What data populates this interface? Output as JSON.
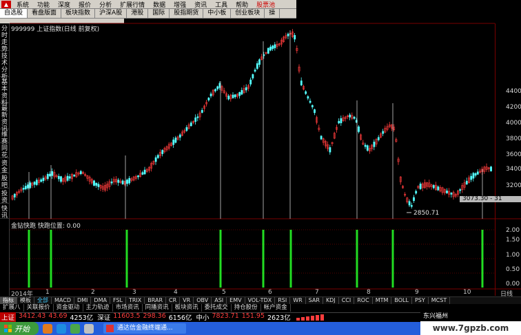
{
  "menu": [
    "系统",
    "功能",
    "深度",
    "报价",
    "分析",
    "扩展行情",
    "数据",
    "增强",
    "资讯",
    "工具",
    "帮助",
    "股票池"
  ],
  "tabs": [
    "自选股",
    "看盘版面",
    "板块指数",
    "沪深A股",
    "港股",
    "国际",
    "股指期货",
    "中小板",
    "创业板块",
    "操"
  ],
  "left_tabs": [
    "分时走势",
    "技术分析",
    "基本资料",
    "最新资讯",
    "维赛",
    "同花",
    "资金",
    "股吧",
    "投资",
    "快讯"
  ],
  "chart": {
    "title": "999999 上证指数(日线 前复权)",
    "y_ticks": [
      "4400",
      "4200",
      "4000",
      "3800",
      "3600",
      "3400",
      "3200",
      "3000"
    ],
    "box_label": "3073.30 - 31",
    "low_label": "2850.71"
  },
  "indicator": {
    "title": "金钻快跑  快跑位置: 0.00",
    "y_ticks": [
      "2.00",
      "1.50",
      "1.00",
      "0.50",
      "0.00"
    ]
  },
  "date_axis": {
    "year": "2014年",
    "months": [
      "1",
      "2",
      "3",
      "4",
      "5",
      "6",
      "7",
      "8",
      "9",
      "10"
    ],
    "period": "日线"
  },
  "indicator_tabs": [
    "指标",
    "模板",
    "全部",
    "MACD",
    "DMI",
    "DMA",
    "FSL",
    "TRIX",
    "BRAR",
    "CR",
    "VR",
    "OBV",
    "ASI",
    "EMV",
    "VOL-TDX",
    "RSI",
    "WR",
    "SAR",
    "KDJ",
    "CCI",
    "ROC",
    "MTM",
    "BOLL",
    "PSY",
    "MCST"
  ],
  "sub_functions": [
    "扩展八",
    "关联报价",
    "资金驱动",
    "主力轨迹",
    "市场资讯",
    "同播资讯",
    "板块资讯",
    "委托成交",
    "持仓股份",
    "帐户资金"
  ],
  "ticker": {
    "sh_label": "上证",
    "sh_value": "3412.43",
    "sh_change": "43.69",
    "sh_amount": "4253亿",
    "sz_label": "深证",
    "sz_value": "11603.5",
    "sz_change": "298.36",
    "sz_amount": "6156亿",
    "zx_label": "中小",
    "zx_value": "7823.71",
    "zx_change": "151.95",
    "zx_amount": "2623亿"
  },
  "news_ticker": "东兴福州",
  "brand_url": "www.7gpzb.com",
  "taskbar": {
    "start_label": "开始",
    "task_label": "通达信金融终端通..."
  },
  "colors": {
    "up_candle": "#ff3c3c",
    "down_candle": "#54ffff",
    "signal_bar": "#22dd22",
    "grid": "#7a0000"
  }
}
